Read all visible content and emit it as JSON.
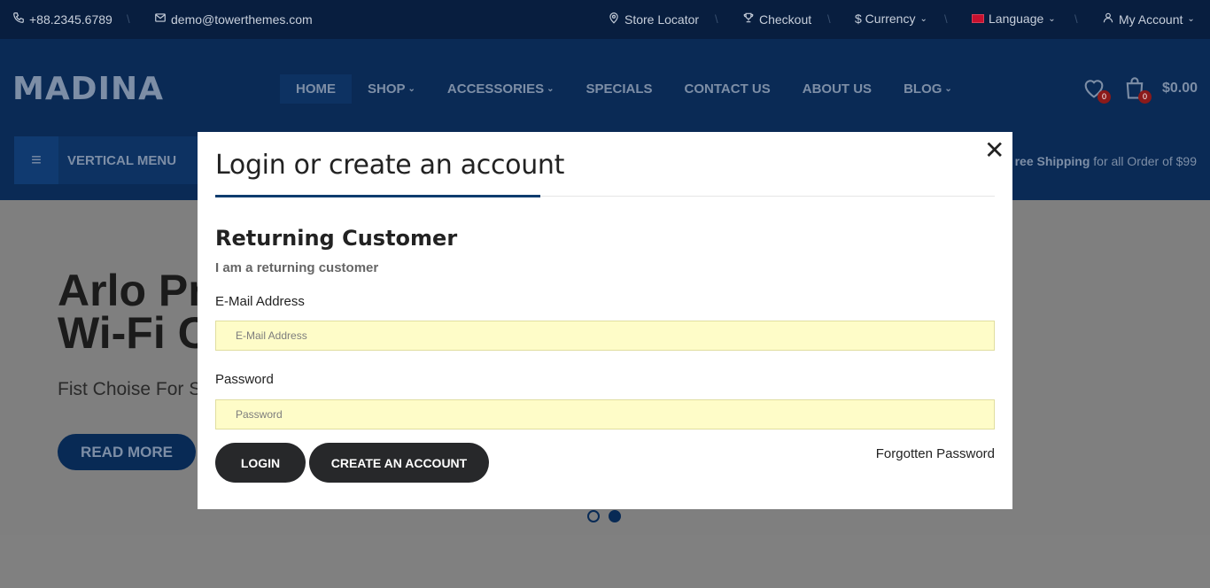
{
  "topbar": {
    "phone": "+88.2345.6789",
    "email": "demo@towerthemes.com",
    "store_locator": "Store Locator",
    "checkout": "Checkout",
    "currency": "$ Currency",
    "language": "Language",
    "account": "My Account"
  },
  "header": {
    "logo": "MADINA",
    "nav": [
      {
        "label": "HOME",
        "active": true
      },
      {
        "label": "SHOP",
        "dropdown": true
      },
      {
        "label": "ACCESSORIES",
        "dropdown": true
      },
      {
        "label": "SPECIALS"
      },
      {
        "label": "CONTACT US"
      },
      {
        "label": "ABOUT US"
      },
      {
        "label": "BLOG",
        "dropdown": true
      }
    ],
    "wishlist_count": "0",
    "cart_count": "0",
    "cart_total": "$0.00"
  },
  "subbar": {
    "vertical_menu": "VERTICAL MENU",
    "shipping_bold": "ree Shipping",
    "shipping_rest": " for all Order of $99"
  },
  "hero": {
    "title_line1": "Arlo Pr",
    "title_line2": "Wi-Fi C",
    "subtitle": "Fist Choise For S",
    "button": "READ MORE"
  },
  "modal": {
    "title": "Login or create an account",
    "section_title": "Returning Customer",
    "section_sub": "I am a returning customer",
    "email_label": "E-Mail Address",
    "email_placeholder": "E-Mail Address",
    "password_label": "Password",
    "password_placeholder": "Password",
    "login_button": "LOGIN",
    "create_button": "CREATE AN ACCOUNT",
    "forgot_link": "Forgotten Password"
  },
  "colors": {
    "topbar": "#081e3f",
    "header": "#0a2a55",
    "accent": "#0e3c6e",
    "input_bg": "#fefcc8",
    "button": "#27282a"
  }
}
